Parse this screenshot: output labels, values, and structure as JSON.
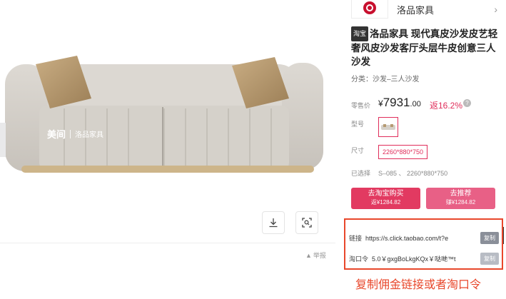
{
  "shop": {
    "name": "洛品家具"
  },
  "product": {
    "platform_badge": "淘宝",
    "title": "洛品家具 现代真皮沙发皮艺轻奢风皮沙发客厅头层牛皮创意三人沙发",
    "category": "分类：沙发–三人沙发",
    "price_label": "零售价",
    "price_currency": "¥",
    "price_integer": "7931",
    "price_decimal": ".00",
    "rebate": "返16.2%",
    "help_icon": "?",
    "model_label": "型号",
    "size_label": "尺寸",
    "size_option": "2260*880*750",
    "selected_label": "已选择",
    "selected_value": "S–085 、 2260*880*750"
  },
  "image": {
    "watermark_logo": "美间",
    "watermark_brand": "洛品家具",
    "report_label": "举报"
  },
  "buttons": {
    "buy_label": "去淘宝购买",
    "buy_sub": "返¥1284.82",
    "recommend_label": "去推荐",
    "recommend_sub": "赚¥1284.82"
  },
  "popup": {
    "link_label": "链接",
    "link_value": "https://s.click.taobao.com/t?e",
    "copy_label_1": "复制",
    "code_label": "淘口令",
    "code_value": "5.0￥gxgBoLkgKQx￥哒哋™t",
    "copy_label_2": "复制"
  },
  "annotation": "复制佣金链接或者淘口令",
  "colors": {
    "accent": "#e02d5a",
    "annotation": "#e8472b"
  },
  "icons": [
    "chevron-right-icon",
    "download-icon",
    "scan-icon",
    "report-icon",
    "help-icon"
  ]
}
